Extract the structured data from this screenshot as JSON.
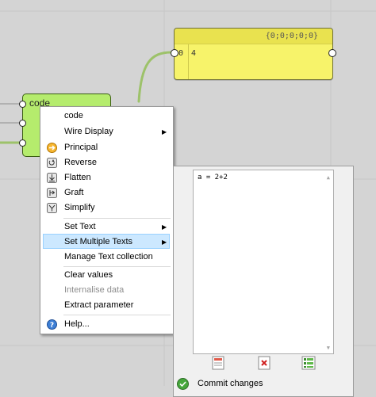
{
  "panel": {
    "path_label": "{0;0;0;0;0}",
    "item_index": "0",
    "item_value": "4"
  },
  "component": {
    "title": "code"
  },
  "context_menu": {
    "items": [
      {
        "label": "code",
        "icon": "none",
        "submenu": false,
        "enabled": true
      },
      {
        "label": "Wire Display",
        "icon": "none",
        "submenu": true,
        "enabled": true
      },
      {
        "label": "Principal",
        "icon": "principal-icon",
        "submenu": false,
        "enabled": true
      },
      {
        "label": "Reverse",
        "icon": "reverse-icon",
        "submenu": false,
        "enabled": true
      },
      {
        "label": "Flatten",
        "icon": "flatten-icon",
        "submenu": false,
        "enabled": true
      },
      {
        "label": "Graft",
        "icon": "graft-icon",
        "submenu": false,
        "enabled": true
      },
      {
        "label": "Simplify",
        "icon": "simplify-icon",
        "submenu": false,
        "enabled": true
      },
      {
        "label": "Set Text",
        "icon": "none",
        "submenu": true,
        "enabled": true
      },
      {
        "label": "Set Multiple Texts",
        "icon": "none",
        "submenu": true,
        "enabled": true,
        "highlighted": true
      },
      {
        "label": "Manage Text collection",
        "icon": "none",
        "submenu": false,
        "enabled": true
      },
      {
        "label": "Clear values",
        "icon": "none",
        "submenu": false,
        "enabled": true
      },
      {
        "label": "Internalise data",
        "icon": "none",
        "submenu": false,
        "enabled": false
      },
      {
        "label": "Extract parameter",
        "icon": "none",
        "submenu": false,
        "enabled": true
      },
      {
        "label": "Help...",
        "icon": "help-icon",
        "submenu": false,
        "enabled": true
      }
    ]
  },
  "editor": {
    "text_value": "a = 2+2",
    "commit_label": "Commit changes"
  },
  "colors": {
    "canvas": "#d4d4d4",
    "panel": "#f7f36a",
    "component": "#b5ec6d",
    "wire": "#9dc26a",
    "highlight": "#cce8ff"
  }
}
